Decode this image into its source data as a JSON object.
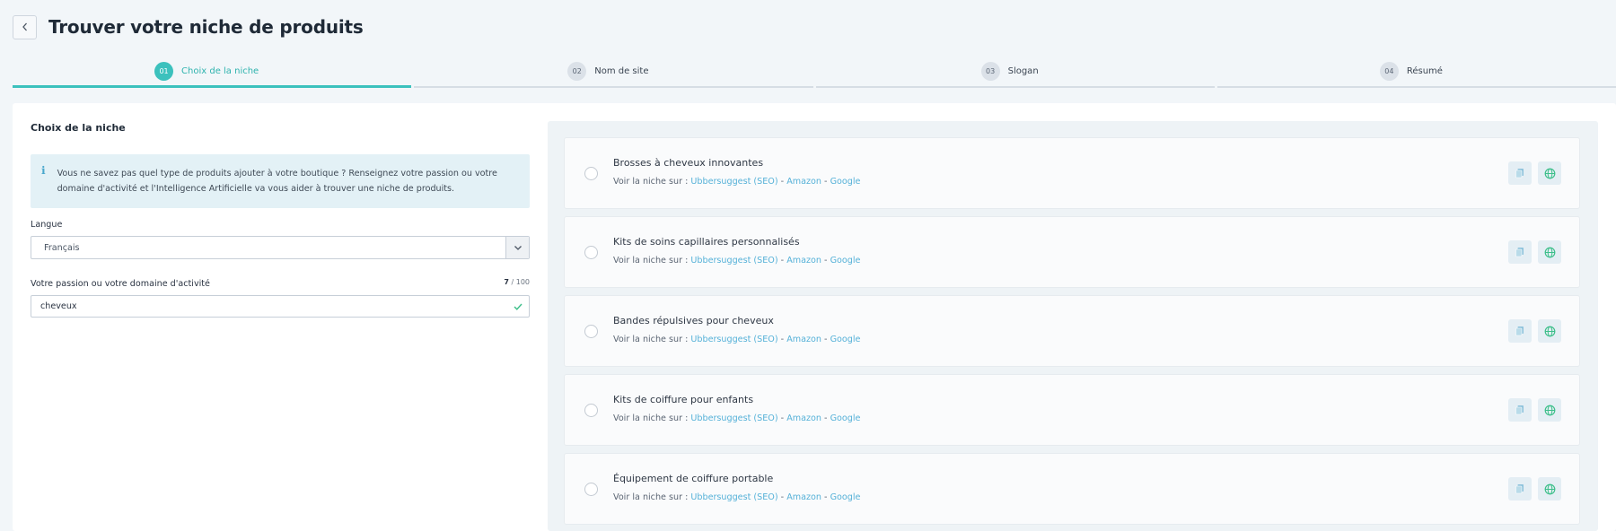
{
  "header": {
    "title": "Trouver votre niche de produits"
  },
  "steps": [
    {
      "num": "01",
      "label": "Choix de la niche",
      "active": true
    },
    {
      "num": "02",
      "label": "Nom de site",
      "active": false
    },
    {
      "num": "03",
      "label": "Slogan",
      "active": false
    },
    {
      "num": "04",
      "label": "Résumé",
      "active": false
    }
  ],
  "form": {
    "section_title": "Choix de la niche",
    "info_text": "Vous ne savez pas quel type de produits ajouter à votre boutique ? Renseignez votre passion ou votre domaine d'activité et l'Intelligence Artificielle va vous aider à trouver une niche de produits.",
    "language_label": "Langue",
    "language_value": "Français",
    "passion_label": "Votre passion ou votre domaine d'activité",
    "passion_count": "7",
    "passion_max": "/ 100",
    "passion_value": "cheveux"
  },
  "niches": {
    "links_prefix": "Voir la niche sur :",
    "link_seo": "Ubbersuggest (SEO)",
    "link_amazon": "Amazon",
    "link_google": "Google",
    "separator": "-",
    "items": [
      {
        "title": "Brosses à cheveux innovantes"
      },
      {
        "title": "Kits de soins capillaires personnalisés"
      },
      {
        "title": "Bandes répulsives pour cheveux"
      },
      {
        "title": "Kits de coiffure pour enfants"
      },
      {
        "title": "Équipement de coiffure portable"
      }
    ]
  },
  "colors": {
    "accent": "#3cc1bd",
    "link": "#55b1d8",
    "globe": "#3dbf8a",
    "copy": "#8fc3dc"
  }
}
